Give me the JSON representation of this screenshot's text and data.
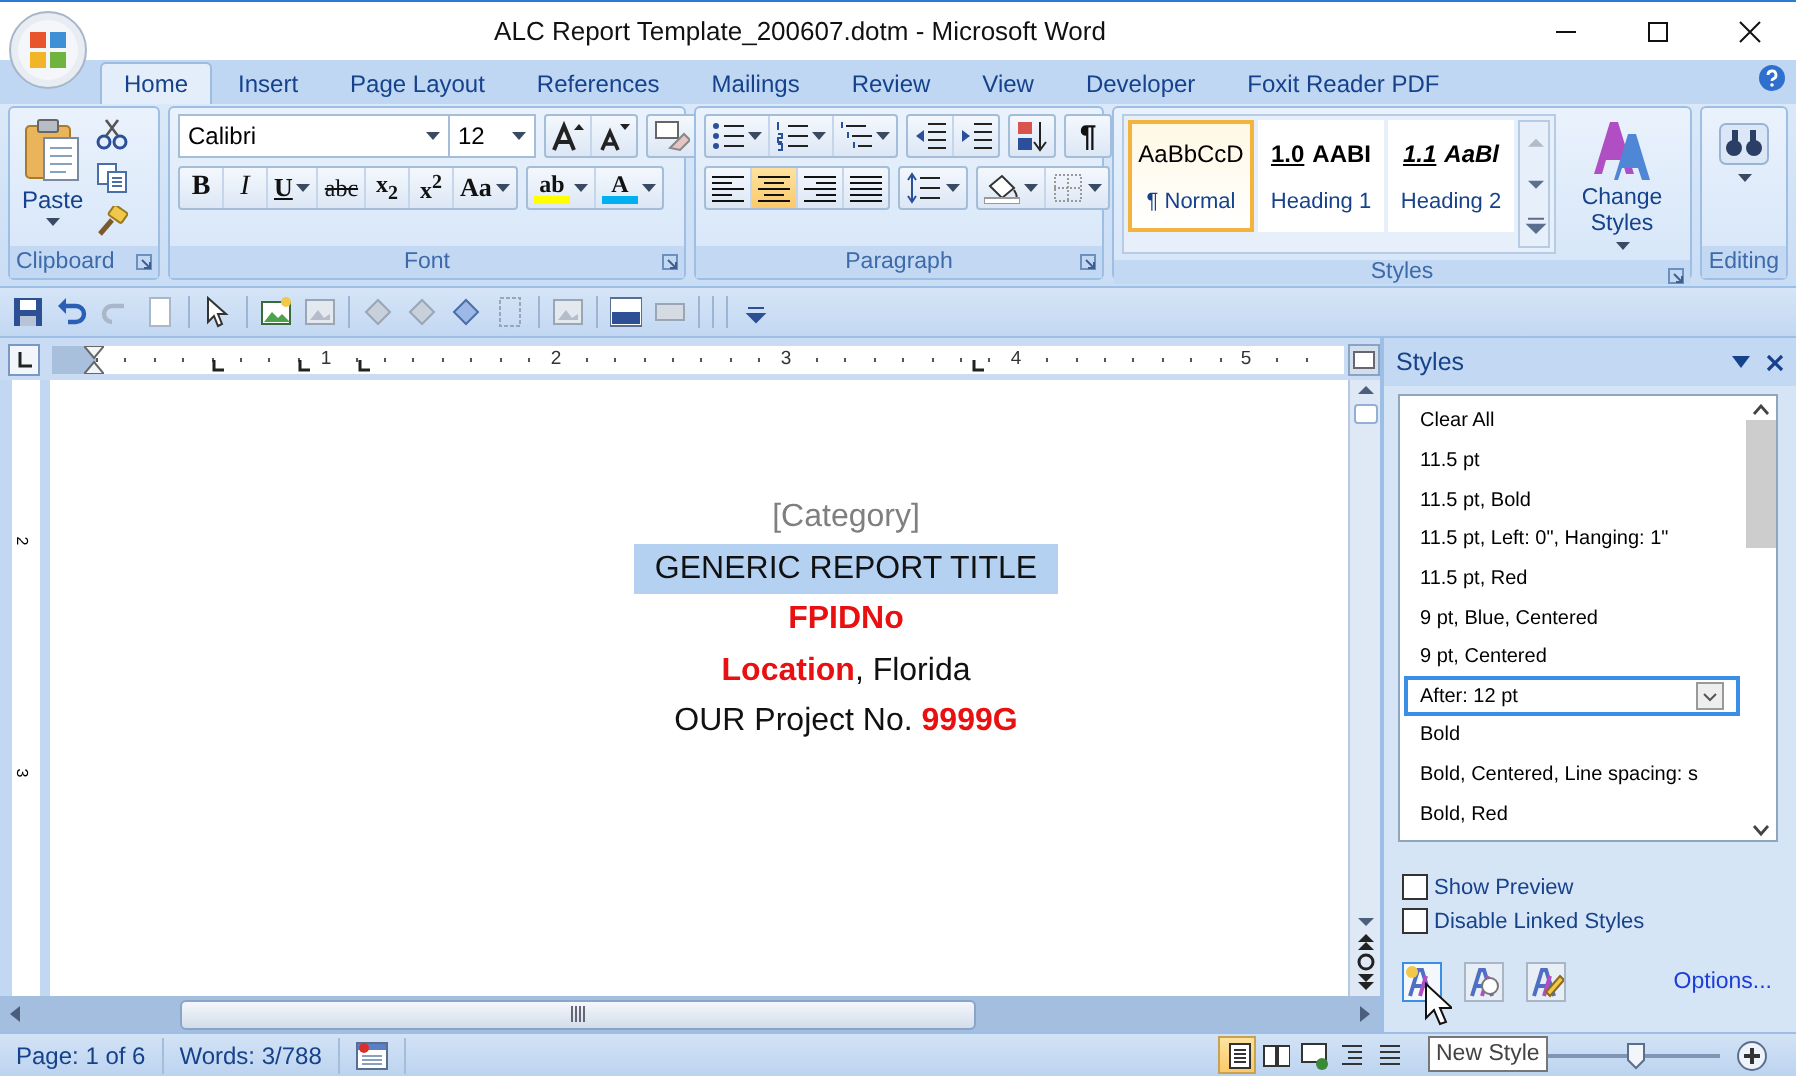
{
  "window": {
    "title": "ALC Report Template_200607.dotm - Microsoft Word"
  },
  "tabs": [
    {
      "label": "Home",
      "selected": true
    },
    {
      "label": "Insert",
      "selected": false
    },
    {
      "label": "Page Layout",
      "selected": false
    },
    {
      "label": "References",
      "selected": false
    },
    {
      "label": "Mailings",
      "selected": false
    },
    {
      "label": "Review",
      "selected": false
    },
    {
      "label": "View",
      "selected": false
    },
    {
      "label": "Developer",
      "selected": false
    },
    {
      "label": "Foxit Reader PDF",
      "selected": false
    }
  ],
  "ribbon": {
    "clipboard": {
      "paste": "Paste",
      "label": "Clipboard"
    },
    "font": {
      "name": "Calibri",
      "size": "12",
      "label": "Font",
      "format_buttons": [
        {
          "label": "B",
          "kind": "bold"
        },
        {
          "label": "I",
          "kind": "italic"
        },
        {
          "label": "U",
          "kind": "underline"
        },
        {
          "label": "abc",
          "kind": "strike"
        },
        {
          "label": "x$_{2}$",
          "kind": "plain"
        },
        {
          "label": "x$^{2}$",
          "kind": "plain"
        },
        {
          "label": "Aa",
          "kind": "serif"
        }
      ],
      "color_buttons": [
        {
          "label": "ab",
          "color": "#ffff00"
        },
        {
          "label": "A",
          "color": "#00b0f0"
        }
      ]
    },
    "paragraph": {
      "label": "Paragraph",
      "pilcrow": "¶",
      "alignments": [
        {
          "selected": false
        },
        {
          "selected": true
        },
        {
          "selected": false
        },
        {
          "selected": false
        }
      ]
    },
    "styles": {
      "label": "Styles",
      "change_styles": "Change Styles",
      "gallery": [
        {
          "sample": "AaBbCcD",
          "name": "¶ Normal",
          "kind": "plain",
          "selected": true
        },
        {
          "number": "1.0",
          "sample": "AABI",
          "name": "Heading 1",
          "kind": "bold",
          "selected": false
        },
        {
          "number": "1.1",
          "sample": "AaBl",
          "name": "Heading 2",
          "kind": "bolditalic",
          "selected": false
        }
      ]
    },
    "editing": {
      "label": "Editing"
    }
  },
  "ruler": {
    "numbers": [
      "1",
      "2",
      "3",
      "4",
      "5"
    ],
    "vertical_numbers": [
      "2",
      "3"
    ]
  },
  "document": {
    "lines": [
      {
        "text": "[Category]",
        "kind": "placeholder",
        "selected": false
      },
      {
        "text": "GENERIC REPORT TITLE",
        "kind": "plain",
        "selected": true
      },
      {
        "text": "FPIDNo",
        "kind": "red",
        "selected": false
      },
      {
        "text": "**Location**, Florida",
        "kind": "plain",
        "selected": false
      },
      {
        "text": "OUR Project No. **9999G**",
        "kind": "plain",
        "selected": false
      }
    ]
  },
  "styles_pane": {
    "title": "Styles",
    "items": [
      {
        "label": "Clear All",
        "selected": false
      },
      {
        "label": "11.5 pt",
        "selected": false
      },
      {
        "label": "11.5 pt, Bold",
        "selected": false
      },
      {
        "label": "11.5 pt, Left:  0\", Hanging:  1\"",
        "selected": false
      },
      {
        "label": "11.5 pt, Red",
        "selected": false
      },
      {
        "label": "9 pt, Blue, Centered",
        "selected": false
      },
      {
        "label": "9 pt, Centered",
        "selected": false
      },
      {
        "label": "After:  12 pt",
        "selected": true
      },
      {
        "label": "Bold",
        "selected": false
      },
      {
        "label": "Bold, Centered, Line spacing:  s",
        "selected": false
      },
      {
        "label": "Bold, Red",
        "selected": false
      }
    ],
    "options": [
      {
        "label": "Show Preview",
        "checked": false
      },
      {
        "label": "Disable Linked Styles",
        "checked": false
      }
    ],
    "link": "Options..."
  },
  "status_bar": {
    "page": "Page: 1 of 6",
    "words": "Words: 3/788",
    "views": [
      {
        "selected": true
      },
      {
        "selected": false
      },
      {
        "selected": false
      },
      {
        "selected": false
      },
      {
        "selected": false
      }
    ],
    "zoom": {
      "level": 0.62
    }
  },
  "tooltip": "New Style"
}
